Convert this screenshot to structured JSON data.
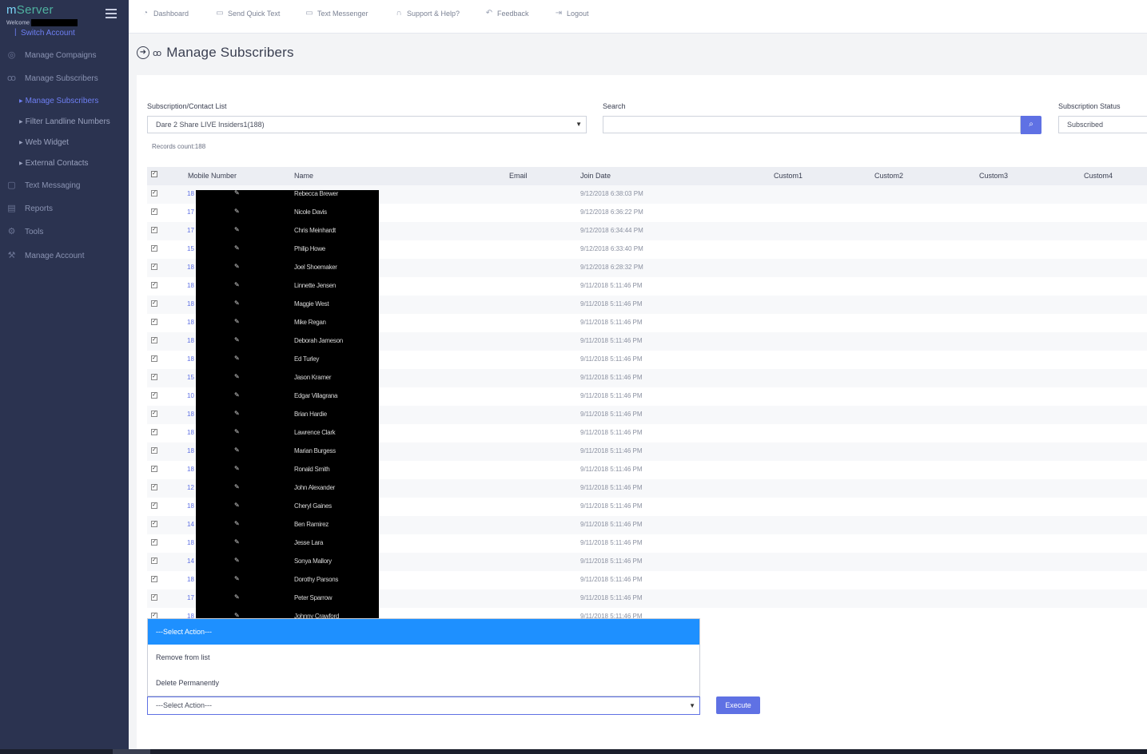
{
  "brand": {
    "prefix": "m",
    "name": "Server"
  },
  "welcome": "Welcome",
  "switch_account": "Switch Account",
  "sidebar": {
    "items": [
      {
        "label": "Manage Compaigns",
        "icon": "campaign-icon"
      },
      {
        "label": "Manage Subscribers",
        "icon": "users-icon"
      },
      {
        "label": "Text Messaging",
        "icon": "message-icon"
      },
      {
        "label": "Reports",
        "icon": "reports-icon"
      },
      {
        "label": "Tools",
        "icon": "gear-icon"
      },
      {
        "label": "Manage Account",
        "icon": "wrench-icon"
      }
    ],
    "sub_items": [
      {
        "label": "Manage Subscribers",
        "active": true
      },
      {
        "label": "Filter Landline Numbers"
      },
      {
        "label": "Web Widget"
      },
      {
        "label": "External Contacts"
      }
    ]
  },
  "topnav": [
    {
      "label": "Dashboard",
      "icon": "dashboard-icon"
    },
    {
      "label": "Send Quick Text",
      "icon": "quick-text-icon"
    },
    {
      "label": "Text Messenger",
      "icon": "messenger-icon"
    },
    {
      "label": "Support & Help?",
      "icon": "headset-icon"
    },
    {
      "label": "Feedback",
      "icon": "feedback-icon"
    },
    {
      "label": "Logout",
      "icon": "logout-icon"
    }
  ],
  "page_title": "Manage Subscribers",
  "filters": {
    "list_label": "Subscription/Contact List",
    "list_value": "Dare 2 Share LIVE Insiders1(188)",
    "search_label": "Search",
    "search_value": "",
    "status_label": "Subscription Status",
    "status_value": "Subscribed"
  },
  "records_count": "Records count:188",
  "table": {
    "columns": [
      "Mobile Number",
      "Name",
      "Email",
      "Join Date",
      "Custom1",
      "Custom2",
      "Custom3",
      "Custom4"
    ],
    "rows": [
      {
        "mobile_prefix": "18",
        "name": "Rebecca Brewer",
        "join_date": "9/12/2018 6:38:03 PM"
      },
      {
        "mobile_prefix": "17",
        "name": "Nicole Davis",
        "join_date": "9/12/2018 6:36:22 PM"
      },
      {
        "mobile_prefix": "17",
        "name": "Chris Meinhardt",
        "join_date": "9/12/2018 6:34:44 PM"
      },
      {
        "mobile_prefix": "15",
        "name": "Philip Howe",
        "join_date": "9/12/2018 6:33:40 PM"
      },
      {
        "mobile_prefix": "18",
        "name": "Joel Shoemaker",
        "join_date": "9/12/2018 6:28:32 PM"
      },
      {
        "mobile_prefix": "18",
        "name": "Linnette Jensen",
        "join_date": "9/11/2018 5:11:46 PM"
      },
      {
        "mobile_prefix": "18",
        "name": "Maggie West",
        "join_date": "9/11/2018 5:11:46 PM"
      },
      {
        "mobile_prefix": "18",
        "name": "Mike Regan",
        "join_date": "9/11/2018 5:11:46 PM"
      },
      {
        "mobile_prefix": "18",
        "name": "Deborah Jameson",
        "join_date": "9/11/2018 5:11:46 PM"
      },
      {
        "mobile_prefix": "18",
        "name": "Ed Turley",
        "join_date": "9/11/2018 5:11:46 PM"
      },
      {
        "mobile_prefix": "15",
        "name": "Jason Kramer",
        "join_date": "9/11/2018 5:11:46 PM"
      },
      {
        "mobile_prefix": "10",
        "name": "Edgar Villagrana",
        "join_date": "9/11/2018 5:11:46 PM"
      },
      {
        "mobile_prefix": "18",
        "name": "Brian Hardie",
        "join_date": "9/11/2018 5:11:46 PM"
      },
      {
        "mobile_prefix": "18",
        "name": "Lawrence Clark",
        "join_date": "9/11/2018 5:11:46 PM"
      },
      {
        "mobile_prefix": "18",
        "name": "Marian Burgess",
        "join_date": "9/11/2018 5:11:46 PM"
      },
      {
        "mobile_prefix": "18",
        "name": "Ronald Smith",
        "join_date": "9/11/2018 5:11:46 PM"
      },
      {
        "mobile_prefix": "12",
        "name": "John Alexander",
        "join_date": "9/11/2018 5:11:46 PM"
      },
      {
        "mobile_prefix": "18",
        "name": "Cheryl Gaines",
        "join_date": "9/11/2018 5:11:46 PM"
      },
      {
        "mobile_prefix": "14",
        "name": "Ben Ramirez",
        "join_date": "9/11/2018 5:11:46 PM"
      },
      {
        "mobile_prefix": "18",
        "name": "Jesse Lara",
        "join_date": "9/11/2018 5:11:46 PM"
      },
      {
        "mobile_prefix": "14",
        "name": "Sonya Mallory",
        "join_date": "9/11/2018 5:11:46 PM"
      },
      {
        "mobile_prefix": "18",
        "name": "Dorothy Parsons",
        "join_date": "9/11/2018 5:11:46 PM"
      },
      {
        "mobile_prefix": "17",
        "name": "Peter Sparrow",
        "join_date": "9/11/2018 5:11:46 PM"
      },
      {
        "mobile_prefix": "18",
        "name": "Johnny Crawford",
        "join_date": "9/11/2018 5:11:46 PM"
      }
    ]
  },
  "action": {
    "options": [
      "---Select Action---",
      "Remove from list",
      "Delete Permanently"
    ],
    "selected": "---Select Action---",
    "execute_label": "Execute"
  },
  "colors": {
    "sidebar_bg": "#2b3350",
    "accent": "#5f71e4",
    "dropdown_highlight": "#1e90ff"
  }
}
